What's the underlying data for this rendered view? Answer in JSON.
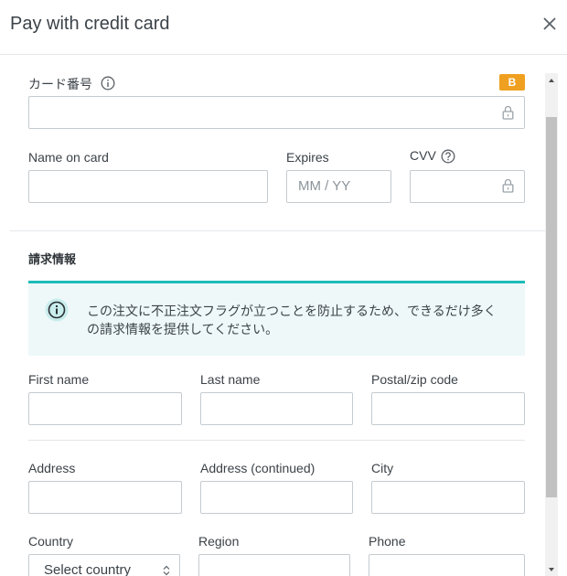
{
  "dialog": {
    "title": "Pay with credit card"
  },
  "card": {
    "number_label": "カード番号",
    "badge": "B",
    "name_label": "Name on card",
    "expires_label": "Expires",
    "expires_placeholder": "MM / YY",
    "cvv_label": "CVV"
  },
  "billing": {
    "section_title": "請求情報",
    "notice": "この注文に不正注文フラグが立つことを防止するため、できるだけ多くの請求情報を提供してください。",
    "first_name_label": "First name",
    "last_name_label": "Last name",
    "postal_label": "Postal/zip code",
    "address_label": "Address",
    "address2_label": "Address (continued)",
    "city_label": "City",
    "country_label": "Country",
    "country_value": "Select country",
    "region_label": "Region",
    "phone_label": "Phone"
  },
  "colors": {
    "badge": "#f0a020",
    "notice_accent": "#1bbbb8",
    "notice_bg": "#eef8f9"
  },
  "icons": [
    "close-icon",
    "info-icon",
    "lock-icon",
    "help-icon",
    "select-arrows-icon"
  ]
}
